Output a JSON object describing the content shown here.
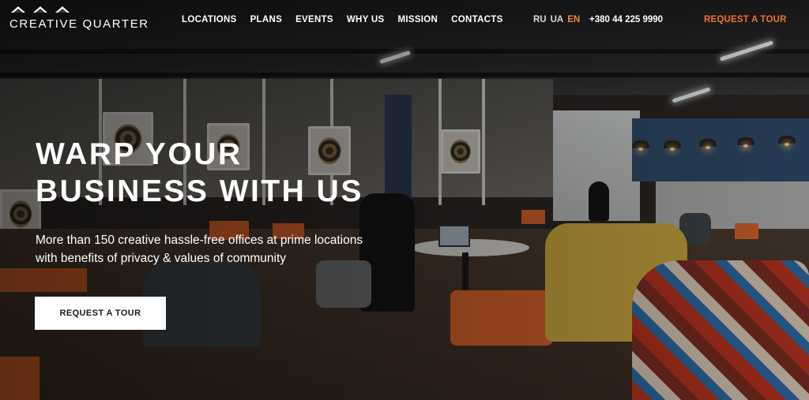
{
  "brand": {
    "name": "CREATIVE QUARTER"
  },
  "nav": {
    "items": [
      {
        "label": "LOCATIONS"
      },
      {
        "label": "PLANS"
      },
      {
        "label": "EVENTS"
      },
      {
        "label": "WHY US"
      },
      {
        "label": "MISSION"
      },
      {
        "label": "CONTACTS"
      }
    ]
  },
  "languages": [
    {
      "code": "RU",
      "active": false
    },
    {
      "code": "UA",
      "active": false
    },
    {
      "code": "EN",
      "active": true
    }
  ],
  "phone": "+380 44 225 9990",
  "header_cta": "REQUEST A TOUR",
  "hero": {
    "headline_line1": "WARP YOUR",
    "headline_line2": "BUSINESS WITH US",
    "subtitle_line1": "More than 150 creative hassle-free offices at prime locations",
    "subtitle_line2": "with benefits of privacy & values of community",
    "cta_label": "REQUEST A TOUR"
  },
  "colors": {
    "accent": "#f0732b",
    "active_language": "#f28c28",
    "cta_background": "#ffffff"
  }
}
